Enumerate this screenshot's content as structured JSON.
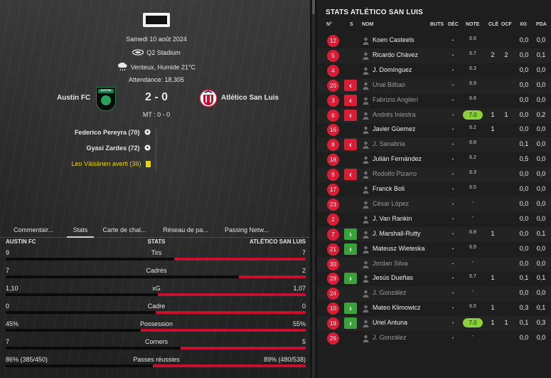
{
  "match": {
    "date": "Samedi 10 août 2024",
    "stadium": "Q2 Stadium",
    "weather": "Venteux, Humide 21°C",
    "attendance": "Attendance: 18,305",
    "home_team": "Austin FC",
    "away_team": "Atlético San Luis",
    "home_crest_text": "AUSTIN",
    "score": "2 - 0",
    "halftime": "MT : 0 - 0",
    "events": [
      {
        "text": "Federico Pereyra (70)",
        "type": "goal"
      },
      {
        "text": "Gyasi Zardes (72)",
        "type": "goal"
      },
      {
        "text": "Leo Väisänen averti (36)",
        "type": "yellow"
      }
    ]
  },
  "tabs": [
    "Commentair...",
    "Stats",
    "Carte de chal...",
    "Réseau de pa...",
    "Passing Netw..."
  ],
  "stats": {
    "home_label": "AUSTIN FC",
    "mid_label": "STATS",
    "away_label": "ATLÉTICO SAN LUIS",
    "rows": [
      {
        "name": "Tirs",
        "home": "9",
        "away": "7",
        "home_share": 0.5625
      },
      {
        "name": "Cadrés",
        "home": "7",
        "away": "2",
        "home_share": 0.7778
      },
      {
        "name": "xG",
        "home": "1,10",
        "away": "1,07",
        "home_share": 0.507
      },
      {
        "name": "Cadre",
        "home": "0",
        "away": "0",
        "home_share": 0.5
      },
      {
        "name": "Possession",
        "home": "45%",
        "away": "55%",
        "home_share": 0.45
      },
      {
        "name": "Corners",
        "home": "7",
        "away": "5",
        "home_share": 0.5833
      },
      {
        "name": "Passes réussies",
        "home": "86% (385/450)",
        "away": "89% (480/538)",
        "home_share": 0.49
      }
    ]
  },
  "player_stats": {
    "title": "STATS ATLÉTICO SAN LUIS",
    "columns": [
      "N°",
      "S",
      "NOM",
      "BUTS",
      "DÉC",
      "NOTE",
      "CLÉ",
      "OCF",
      "XG",
      "PDA"
    ],
    "players": [
      {
        "num": "12",
        "sub": "",
        "name": "Koen Casteels",
        "buts": "",
        "dec": "-",
        "note": "6.6",
        "cle": "",
        "ocf": "",
        "xg": "0,0",
        "pda": "0,0",
        "dim": false
      },
      {
        "num": "5",
        "sub": "",
        "name": "Ricardo Chávez",
        "buts": "",
        "dec": "-",
        "note": "6.7",
        "cle": "2",
        "ocf": "2",
        "xg": "0,0",
        "pda": "0,1",
        "dim": false
      },
      {
        "num": "4",
        "sub": "",
        "name": "J. Domínguez",
        "buts": "",
        "dec": "-",
        "note": "6.3",
        "cle": "",
        "ocf": "",
        "xg": "0,0",
        "pda": "0,0",
        "dim": false
      },
      {
        "num": "20",
        "sub": "out",
        "name": "Unai Bilbao",
        "buts": "",
        "dec": "-",
        "note": "6.9",
        "cle": "",
        "ocf": "",
        "xg": "0,0",
        "pda": "0,0",
        "dim": true
      },
      {
        "num": "3",
        "sub": "out",
        "name": "Fabrizio Angileri",
        "buts": "",
        "dec": "-",
        "note": "6.6",
        "cle": "",
        "ocf": "",
        "xg": "0,0",
        "pda": "0,0",
        "dim": true
      },
      {
        "num": "6",
        "sub": "out",
        "name": "Andrés Iniestra",
        "buts": "",
        "dec": "-",
        "note": "7.0",
        "cle": "1",
        "ocf": "1",
        "xg": "0,0",
        "pda": "0,2",
        "dim": true,
        "hi": true
      },
      {
        "num": "16",
        "sub": "",
        "name": "Javier Güemez",
        "buts": "",
        "dec": "-",
        "note": "6.2",
        "cle": "1",
        "ocf": "",
        "xg": "0,0",
        "pda": "0,0",
        "dim": false
      },
      {
        "num": "8",
        "sub": "out",
        "name": "J. Sanabria",
        "buts": "",
        "dec": "-",
        "note": "6.8",
        "cle": "",
        "ocf": "",
        "xg": "0,1",
        "pda": "0,0",
        "dim": true
      },
      {
        "num": "18",
        "sub": "",
        "name": "Julián Fernández",
        "buts": "",
        "dec": "-",
        "note": "6.2",
        "cle": "",
        "ocf": "",
        "xg": "0,5",
        "pda": "0,0",
        "dim": false
      },
      {
        "num": "9",
        "sub": "out",
        "name": "Rodolfo Pizarro",
        "buts": "",
        "dec": "-",
        "note": "6.3",
        "cle": "",
        "ocf": "",
        "xg": "0,0",
        "pda": "0,0",
        "dim": true
      },
      {
        "num": "17",
        "sub": "",
        "name": "Franck Boli",
        "buts": "",
        "dec": "-",
        "note": "6.5",
        "cle": "",
        "ocf": "",
        "xg": "0,0",
        "pda": "0,0",
        "dim": false
      },
      {
        "num": "23",
        "sub": "",
        "name": "César López",
        "buts": "",
        "dec": "-",
        "note": "-",
        "cle": "",
        "ocf": "",
        "xg": "0,0",
        "pda": "0,0",
        "dim": true
      },
      {
        "num": "2",
        "sub": "",
        "name": "J. Van Rankin",
        "buts": "",
        "dec": "-",
        "note": "-",
        "cle": "",
        "ocf": "",
        "xg": "0,0",
        "pda": "0,0",
        "dim": false
      },
      {
        "num": "7",
        "sub": "in",
        "name": "J. Marshall-Rutty",
        "buts": "",
        "dec": "-",
        "note": "6.8",
        "cle": "1",
        "ocf": "",
        "xg": "0,0",
        "pda": "0,1",
        "dim": false
      },
      {
        "num": "21",
        "sub": "in",
        "name": "Mateusz Wieteska",
        "buts": "",
        "dec": "-",
        "note": "6.9",
        "cle": "",
        "ocf": "",
        "xg": "0,0",
        "pda": "0,0",
        "dim": false
      },
      {
        "num": "30",
        "sub": "",
        "name": "Jordan Silva",
        "buts": "",
        "dec": "-",
        "note": "-",
        "cle": "",
        "ocf": "",
        "xg": "0,0",
        "pda": "0,0",
        "dim": true
      },
      {
        "num": "29",
        "sub": "in",
        "name": "Jesús Dueñas",
        "buts": "",
        "dec": "-",
        "note": "6.7",
        "cle": "1",
        "ocf": "",
        "xg": "0,1",
        "pda": "0,1",
        "dim": false
      },
      {
        "num": "24",
        "sub": "",
        "name": "J. González",
        "buts": "",
        "dec": "-",
        "note": "-",
        "cle": "",
        "ocf": "",
        "xg": "0,0",
        "pda": "0,0",
        "dim": true
      },
      {
        "num": "10",
        "sub": "in",
        "name": "Mateo Klimowicz",
        "buts": "",
        "dec": "-",
        "note": "6.5",
        "cle": "1",
        "ocf": "",
        "xg": "0,3",
        "pda": "0,1",
        "dim": false
      },
      {
        "num": "19",
        "sub": "in",
        "name": "Uriel Antuna",
        "buts": "",
        "dec": "-",
        "note": "7.0",
        "cle": "1",
        "ocf": "1",
        "xg": "0,1",
        "pda": "0,3",
        "dim": false,
        "hi": true
      },
      {
        "num": "26",
        "sub": "",
        "name": "J. González",
        "buts": "",
        "dec": "-",
        "note": "-",
        "cle": "",
        "ocf": "",
        "xg": "0,0",
        "pda": "0,0",
        "dim": true
      }
    ]
  },
  "colors": {
    "away_accent": "#c8102e",
    "home_accent": "#0a0a0a",
    "sub_in": "#3aa23a",
    "sub_out": "#d81e34",
    "rating_high": "#8bd13a"
  },
  "icons": {
    "stadium": "stadium-icon",
    "weather": "cloud-rain-icon",
    "goal": "ball-icon",
    "yellow": "yellow-card-icon",
    "player": "person-icon",
    "sub_in": "chevron-right-icon",
    "sub_out": "chevron-left-icon"
  }
}
